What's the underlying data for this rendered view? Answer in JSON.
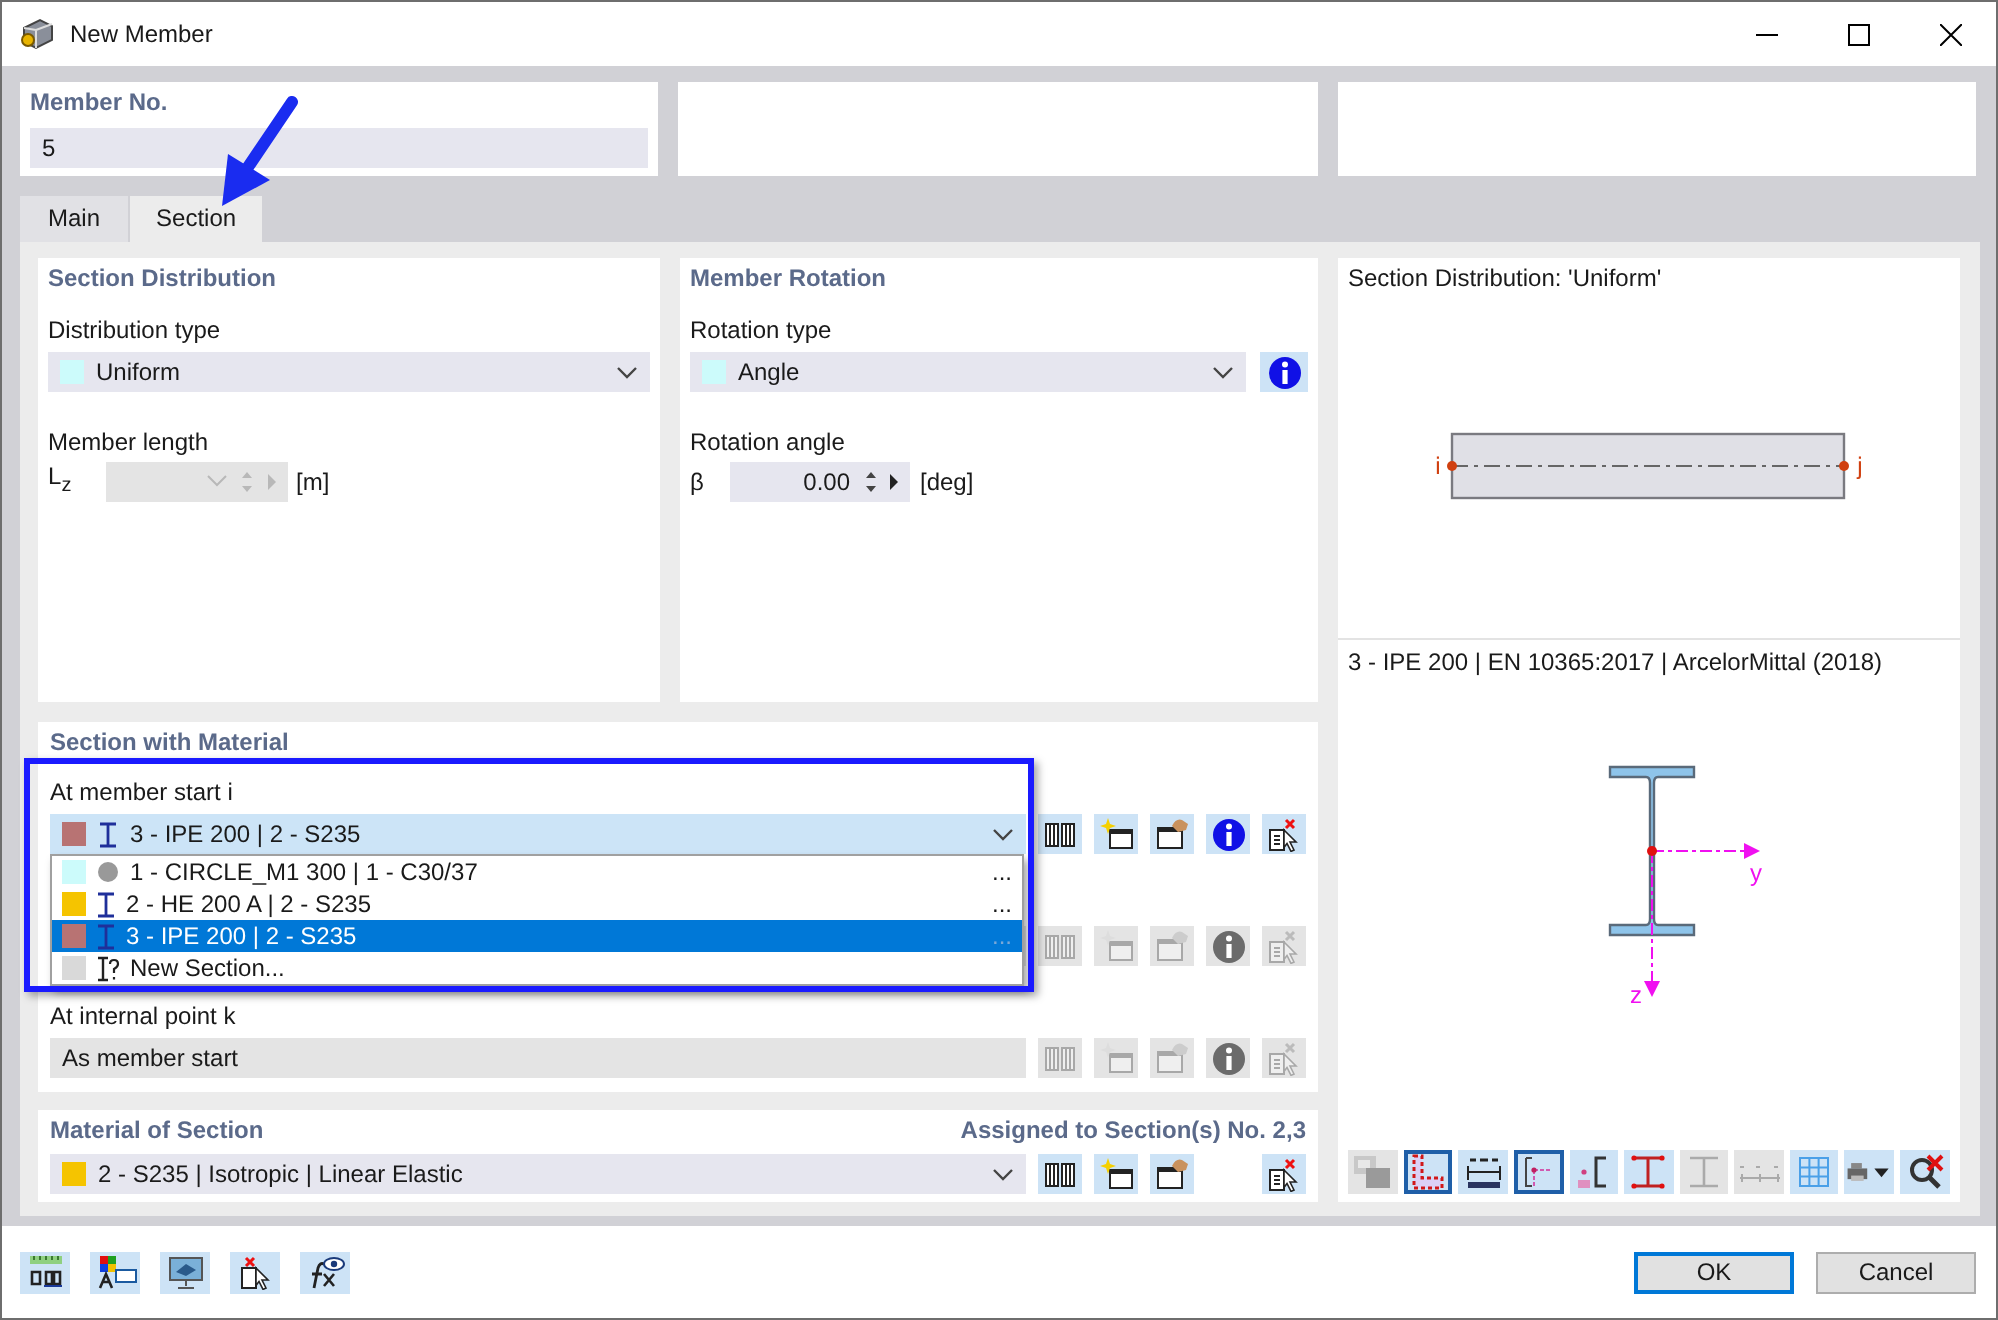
{
  "window": {
    "title": "New Member"
  },
  "member_no": {
    "label": "Member No.",
    "value": "5"
  },
  "tabs": [
    {
      "label": "Main",
      "selected": false
    },
    {
      "label": "Section",
      "selected": true
    }
  ],
  "section_distribution": {
    "title": "Section Distribution",
    "type_label": "Distribution type",
    "type_value": "Uniform",
    "length_label": "Member length",
    "length_symbol": "L$_{z}$",
    "length_unit": "[m]",
    "length_disabled": true
  },
  "member_rotation": {
    "title": "Member Rotation",
    "type_label": "Rotation type",
    "type_value": "Angle",
    "angle_label": "Rotation angle",
    "angle_symbol": "β",
    "angle_value": "0.00",
    "angle_unit": "[deg]"
  },
  "section_with_material": {
    "title": "Section with Material",
    "rows": [
      {
        "kind": "start",
        "label": "At member start i",
        "value": "3 - IPE 200 | 2 - S235",
        "color": "#b87373",
        "icon": {
          "kind": "ibeam"
        },
        "disabled": false
      },
      {
        "kind": "end",
        "disabled": true
      },
      {
        "kind": "internal",
        "label": "At internal point k",
        "value": "As member start",
        "disabled": true
      }
    ],
    "dropdown": {
      "items": [
        {
          "label": "1 - CIRCLE_M1 300 | 1 - C30/37",
          "color": "#ccfbfb",
          "kind": "circle",
          "more": "...",
          "selected": false
        },
        {
          "label": "2 - HE 200 A | 2 - S235",
          "color": "#f5c400",
          "kind": "ibeam",
          "more": "...",
          "selected": false
        },
        {
          "label": "3 - IPE 200 | 2 - S235",
          "color": "#b87373",
          "kind": "ibeam",
          "more": "...",
          "selected": true
        },
        {
          "label": "New Section...",
          "color": "#d9d9d9",
          "kind": "new",
          "selected": false
        }
      ]
    }
  },
  "material_of_section": {
    "title": "Material of Section",
    "assigned": "Assigned to Section(s) No. 2,3",
    "value": "2 - S235 | Isotropic | Linear Elastic",
    "color": "#f5c400"
  },
  "preview": {
    "title": "Section Distribution: 'Uniform'",
    "start_node": "i",
    "end_node": "j",
    "section_caption": "3 - IPE 200 | EN 10365:2017 | ArcelorMittal (2018)",
    "axis_y": "y",
    "axis_z": "z",
    "toolbar": [
      {
        "kind": "render",
        "on": false,
        "disabled": true
      },
      {
        "kind": "outline",
        "on": true,
        "disabled": false
      },
      {
        "kind": "dimensions",
        "on": false,
        "disabled": false
      },
      {
        "kind": "axes",
        "on": true,
        "disabled": false
      },
      {
        "kind": "shear_center",
        "on": false,
        "disabled": false
      },
      {
        "kind": "points",
        "on": false,
        "disabled": false
      },
      {
        "kind": "section",
        "on": false,
        "disabled": true
      },
      {
        "kind": "numbering",
        "on": false,
        "disabled": true
      },
      {
        "kind": "grid",
        "on": false,
        "disabled": false
      },
      {
        "kind": "print",
        "on": false,
        "disabled": false
      },
      {
        "kind": "zoom_reset",
        "on": false,
        "disabled": false
      }
    ]
  },
  "footer": {
    "tools": [
      {
        "kind": "units"
      },
      {
        "kind": "colors"
      },
      {
        "kind": "display"
      },
      {
        "kind": "delete"
      },
      {
        "kind": "formula"
      }
    ],
    "buttons": [
      {
        "label": "OK",
        "default": true
      },
      {
        "label": "Cancel",
        "default": false
      }
    ]
  },
  "annotations": {
    "pointer_arrow": true,
    "highlight_frame": true
  }
}
